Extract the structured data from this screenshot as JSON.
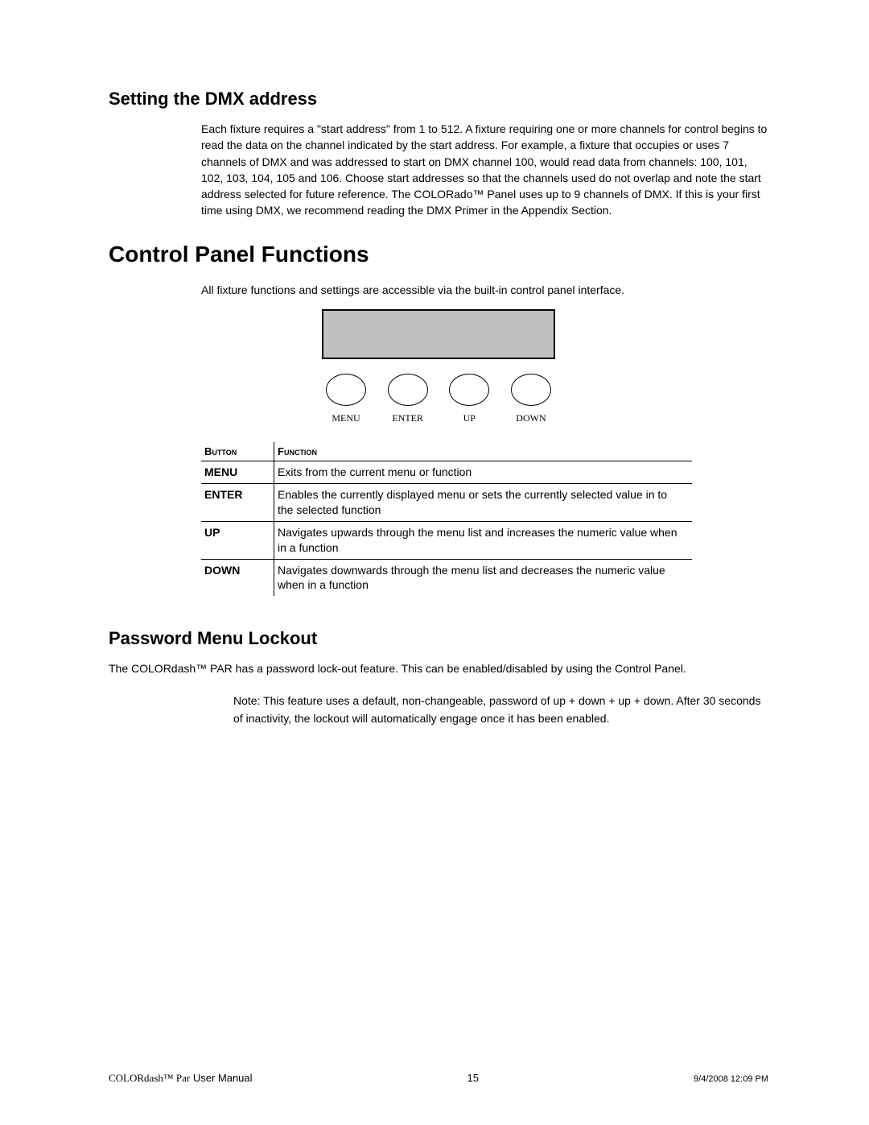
{
  "section1": {
    "heading": "Setting the DMX address",
    "body": "Each fixture requires a \"start address\" from 1 to 512. A fixture requiring one or more channels for control begins to read the data on the channel indicated by the start address. For example, a fixture that occupies or uses 7 channels of DMX and was addressed to start on DMX channel 100, would read data from channels: 100, 101, 102, 103, 104, 105 and 106. Choose start addresses so that the channels used do not overlap and note the start address selected for future reference. The COLORado™ Panel uses up to 9 channels of DMX.  If this is your first time using DMX, we recommend reading the DMX Primer in the Appendix Section."
  },
  "section2": {
    "heading": "Control Panel Functions",
    "intro": "All fixture functions and settings are accessible via the built-in control panel interface.",
    "buttons": [
      {
        "label": "MENU"
      },
      {
        "label": "ENTER"
      },
      {
        "label": "UP"
      },
      {
        "label": "DOWN"
      }
    ],
    "table": {
      "head_button": "Button",
      "head_function": "Function",
      "rows": [
        {
          "button": "MENU",
          "function": "Exits from the current menu or function"
        },
        {
          "button": "ENTER",
          "function": "Enables the currently displayed menu or sets the currently selected value in to the selected function"
        },
        {
          "button": "UP",
          "function": "Navigates upwards through the menu list and increases the numeric value when in a function"
        },
        {
          "button": "DOWN",
          "function": "Navigates downwards through the menu list and decreases the numeric value when in a function"
        }
      ]
    }
  },
  "section3": {
    "heading": "Password Menu Lockout",
    "body": "The COLORdash™ PAR has a password lock-out feature. This can be enabled/disabled by using the Control Panel.",
    "note": "Note: This feature uses a default, non-changeable, password of up + down + up + down. After 30 seconds of inactivity, the lockout will automatically engage once it has been enabled."
  },
  "footer": {
    "product_serif": "COLORdash™ Par",
    "product_sans": " User Manual",
    "page": "15",
    "timestamp": "9/4/2008 12:09 PM"
  }
}
